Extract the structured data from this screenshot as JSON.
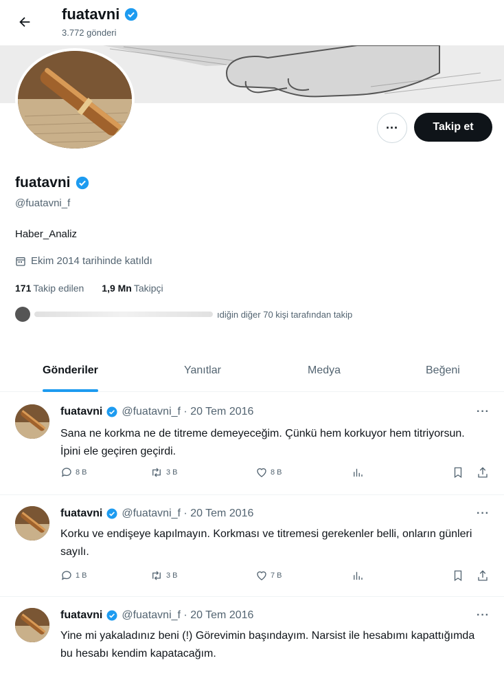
{
  "topbar": {
    "name": "fuatavni",
    "posts": "3.772 gönderi"
  },
  "profile": {
    "name": "fuatavni",
    "handle": "@fuatavni_f",
    "bio": "Haber_Analiz",
    "joined": "Ekim 2014 tarihinde katıldı",
    "following_count": "171",
    "following_label": "Takip edilen",
    "followers_count": "1,9 Mn",
    "followers_label": "Takipçi",
    "followed_by_text": "ıdiğin diğer 70 kişi tarafından takip"
  },
  "buttons": {
    "more": "···",
    "follow": "Takip et"
  },
  "tabs": [
    {
      "label": "Gönderiler",
      "active": true
    },
    {
      "label": "Yanıtlar",
      "active": false
    },
    {
      "label": "Medya",
      "active": false
    },
    {
      "label": "Beğeni",
      "active": false
    }
  ],
  "tweets": [
    {
      "name": "fuatavni",
      "meta": "@fuatavni_f · 20 Tem 2016",
      "text": "Sana ne korkma ne de titreme demeyeceğim. Çünkü hem korkuyor hem titriyorsun. İpini ele geçiren geçirdi.",
      "replies": "8 B",
      "retweets": "3 B",
      "likes": "8 B"
    },
    {
      "name": "fuatavni",
      "meta": "@fuatavni_f · 20 Tem 2016",
      "text": "Korku ve endişeye kapılmayın. Korkması ve titremesi gerekenler belli, onların günleri sayılı.",
      "replies": "1 B",
      "retweets": "3 B",
      "likes": "7 B"
    },
    {
      "name": "fuatavni",
      "meta": "@fuatavni_f · 20 Tem 2016",
      "text": "Yine mi yakaladınız beni (!) Görevimin başındayım. Narsist ile hesabımı kapattığımda bu hesabı kendim kapatacağım.",
      "replies": "",
      "retweets": "",
      "likes": ""
    }
  ],
  "colors": {
    "accent": "#1d9bf0",
    "verified": "#1d9bf0",
    "text": "#0f1419",
    "muted": "#536471"
  }
}
